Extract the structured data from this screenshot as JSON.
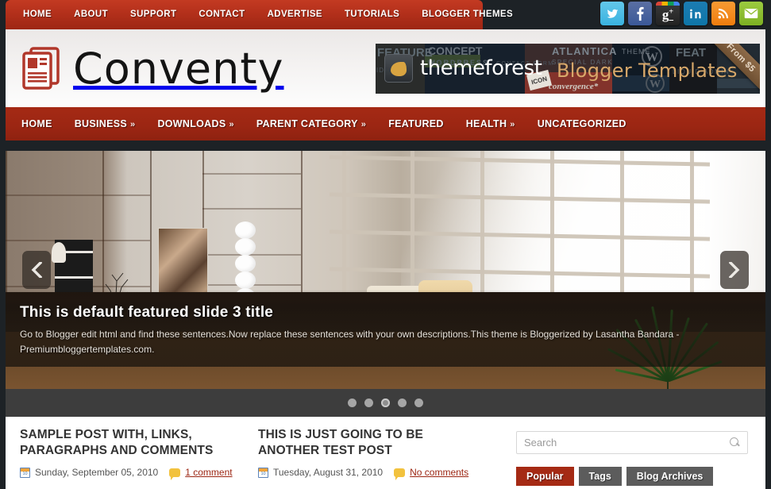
{
  "topnav": {
    "items": [
      {
        "label": "HOME"
      },
      {
        "label": "ABOUT"
      },
      {
        "label": "SUPPORT"
      },
      {
        "label": "CONTACT"
      },
      {
        "label": "ADVERTISE"
      },
      {
        "label": "TUTORIALS"
      },
      {
        "label": "BLOGGER THEMES"
      }
    ]
  },
  "social": {
    "items": [
      {
        "name": "twitter-icon",
        "glyph": "t"
      },
      {
        "name": "facebook-icon",
        "glyph": "f"
      },
      {
        "name": "google-plus-icon",
        "glyph": "g+"
      },
      {
        "name": "linkedin-icon",
        "glyph": "in"
      },
      {
        "name": "rss-icon",
        "glyph": "◜"
      },
      {
        "name": "email-icon",
        "glyph": "✉"
      }
    ]
  },
  "header": {
    "logo_text": "Conventy",
    "logo_icon": "newspaper-icon"
  },
  "banner": {
    "brand": "themeforest",
    "tagline": "Blogger Templates",
    "ribbon": "From $5"
  },
  "mainnav": {
    "items": [
      {
        "label": "HOME",
        "caret": ""
      },
      {
        "label": "BUSINESS",
        "caret": "»"
      },
      {
        "label": "DOWNLOADS",
        "caret": "»"
      },
      {
        "label": "PARENT CATEGORY",
        "caret": "»"
      },
      {
        "label": "FEATURED",
        "caret": ""
      },
      {
        "label": "HEALTH",
        "caret": "»"
      },
      {
        "label": "UNCATEGORIZED",
        "caret": ""
      }
    ]
  },
  "slider": {
    "title": "This is default featured slide 3 title",
    "description": "Go to Blogger edit html and find these sentences.Now replace these sentences with your own descriptions.This theme is Bloggerized by Lasantha Bandara - Premiumbloggertemplates.com.",
    "prev_label": "‹",
    "next_label": "›",
    "dot_count": 5,
    "active_dot": 3
  },
  "posts": [
    {
      "title": "SAMPLE POST WITH, LINKS, PARAGRAPHS AND COMMENTS",
      "date": "Sunday, September 05, 2010",
      "comments": "1 comment"
    },
    {
      "title": "THIS IS JUST GOING TO BE ANOTHER TEST POST",
      "date": "Tuesday, August 31, 2010",
      "comments": "No comments"
    }
  ],
  "sidebar": {
    "search_placeholder": "Search",
    "search_value": "",
    "tabs": [
      {
        "label": "Popular",
        "active": true
      },
      {
        "label": "Tags",
        "active": false
      },
      {
        "label": "Blog Archives",
        "active": false
      }
    ]
  },
  "colors": {
    "brand_red": "#a52a14",
    "topbar_red": "#b3301b",
    "dark_bg": "#1d2226",
    "dots_bar": "#3d3d3d"
  }
}
